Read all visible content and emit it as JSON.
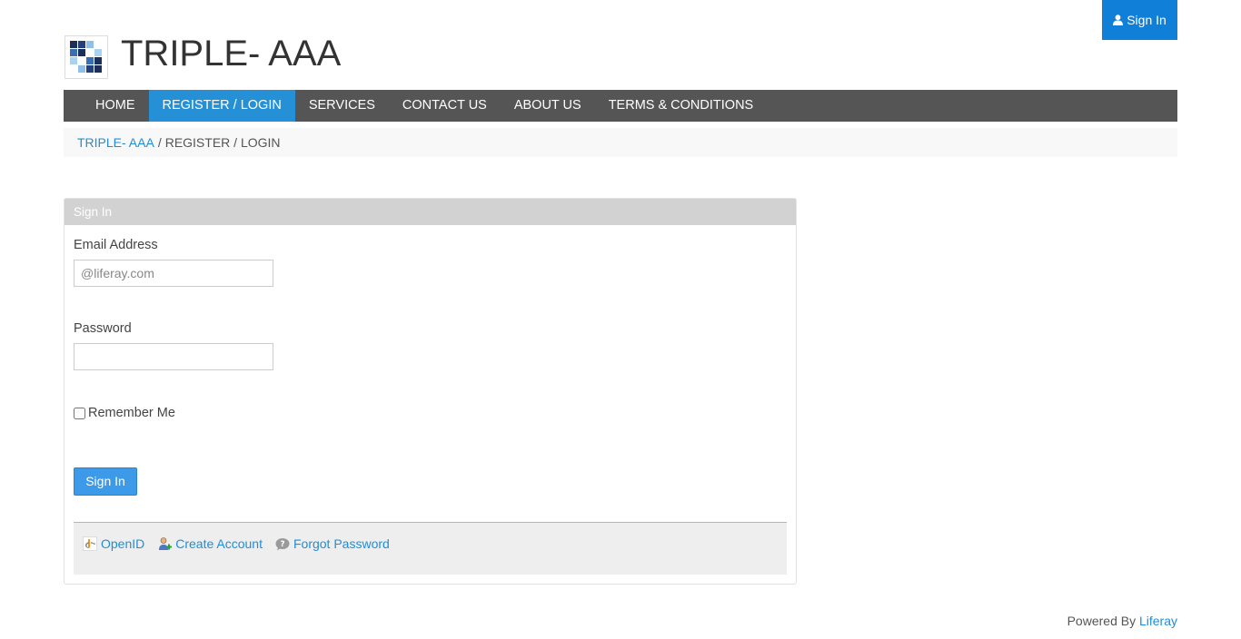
{
  "header": {
    "signin_label": "Sign In",
    "site_title": "TRIPLE- AAA"
  },
  "nav": {
    "items": [
      {
        "label": "HOME",
        "active": false
      },
      {
        "label": "REGISTER / LOGIN",
        "active": true
      },
      {
        "label": "SERVICES",
        "active": false
      },
      {
        "label": "CONTACT US",
        "active": false
      },
      {
        "label": "ABOUT US",
        "active": false
      },
      {
        "label": "TERMS & CONDITIONS",
        "active": false
      }
    ]
  },
  "breadcrumb": {
    "root": "TRIPLE- AAA",
    "separator": "/",
    "current": "REGISTER / LOGIN"
  },
  "login": {
    "panel_title": "Sign In",
    "email_label": "Email Address",
    "email_placeholder": "@liferay.com",
    "email_value": "",
    "password_label": "Password",
    "password_value": "",
    "remember_label": "Remember Me",
    "submit_label": "Sign In",
    "links": {
      "openid": "OpenID",
      "create_account": "Create Account",
      "forgot_password": "Forgot Password"
    }
  },
  "footer": {
    "powered_by": "Powered By",
    "powered_link": "Liferay"
  },
  "colors": {
    "accent": "#2690d6",
    "signin_top": "#0f7fd8",
    "navbar": "#555555",
    "panel_head": "#d2d2d2",
    "link": "#1e8fd6"
  }
}
